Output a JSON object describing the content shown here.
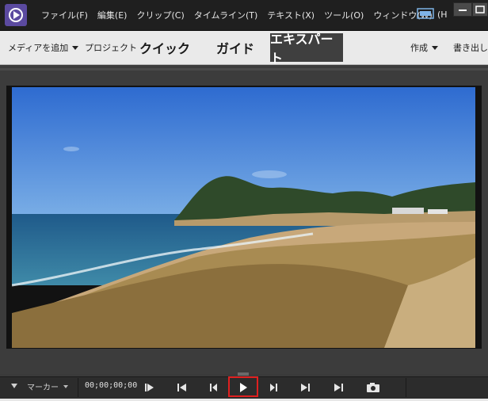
{
  "menubar": {
    "items": [
      "ファイル(F)",
      "編集(E)",
      "クリップ(C)",
      "タイムライン(T)",
      "テキスト(X)",
      "ツール(O)",
      "ウィンドウ(W)"
    ],
    "help_fragment": "(H"
  },
  "toolbar": {
    "add_media": "メディアを追加",
    "project": "プロジェクト",
    "quick": "クイック",
    "guided": "ガイド",
    "expert": "エキスパート",
    "create": "作成",
    "export": "書き出し"
  },
  "controls": {
    "marker_label": "マーカー",
    "timecode": "00;00;00;00"
  },
  "icons": {
    "app": "premiere-elements-icon",
    "monitor": "monitor-icon",
    "snapshot": "camera-icon"
  },
  "colors": {
    "accent_highlight": "#e02020"
  }
}
